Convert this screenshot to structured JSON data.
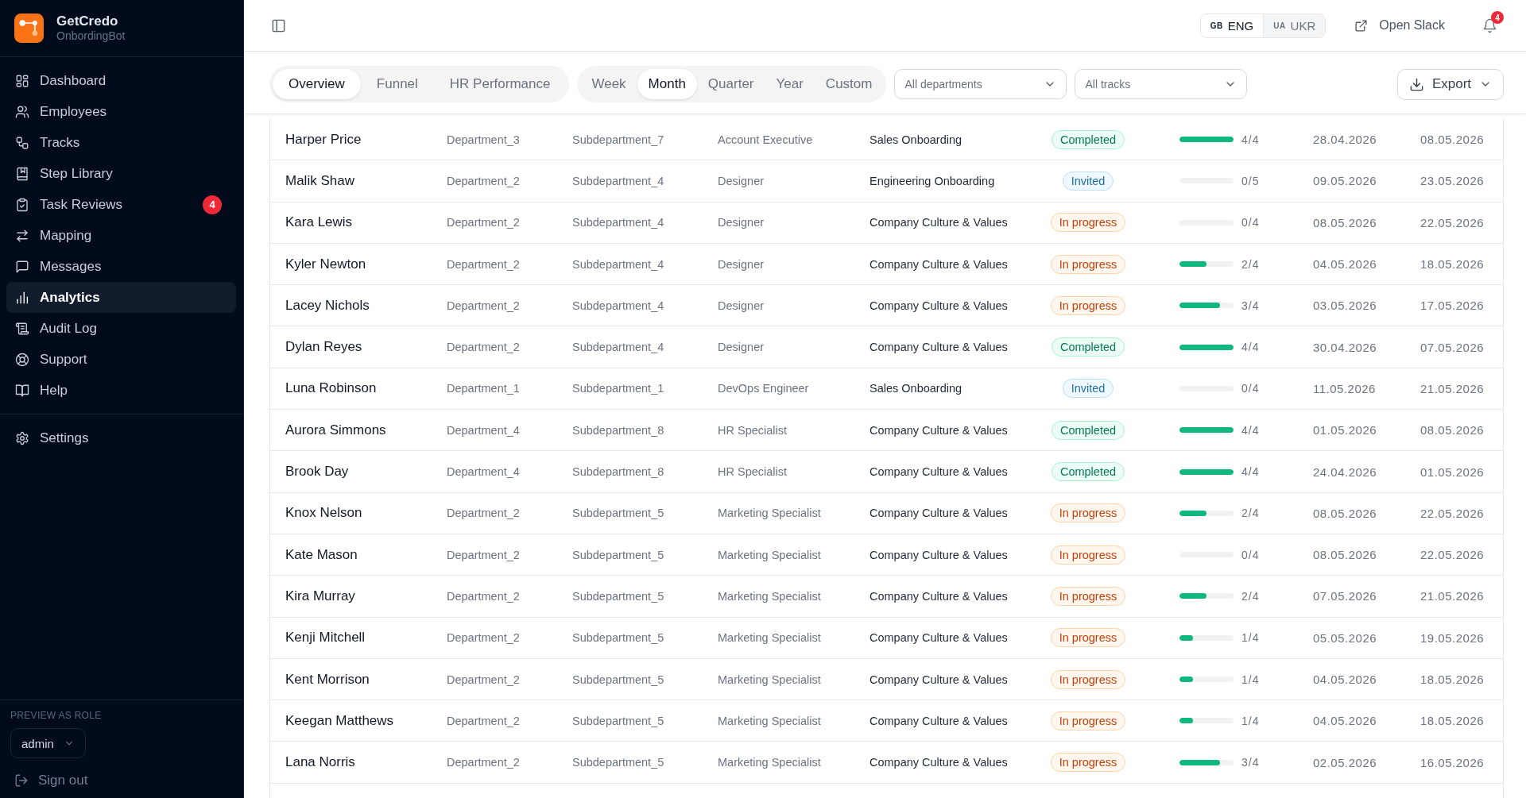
{
  "sidebar": {
    "brand": {
      "name": "GetCredo",
      "subtitle": "OnbordingBot"
    },
    "nav": [
      {
        "label": "Dashboard",
        "selected": false
      },
      {
        "label": "Employees",
        "selected": false
      },
      {
        "label": "Tracks",
        "selected": false
      },
      {
        "label": "Step Library",
        "selected": false
      },
      {
        "label": "Task Reviews",
        "selected": false,
        "badge": "4"
      },
      {
        "label": "Mapping",
        "selected": false
      },
      {
        "label": "Messages",
        "selected": false
      },
      {
        "label": "Analytics",
        "selected": true
      },
      {
        "label": "Audit Log",
        "selected": false
      },
      {
        "label": "Support",
        "selected": false
      },
      {
        "label": "Help",
        "selected": false
      }
    ],
    "footer_nav": [
      {
        "label": "Settings",
        "selected": false
      }
    ],
    "role_preview": {
      "label": "PREVIEW AS ROLE",
      "value": "admin"
    },
    "sign_out": "Sign out"
  },
  "topbar": {
    "languages": [
      {
        "code": "GB",
        "label": "ENG",
        "selected": true
      },
      {
        "code": "UA",
        "label": "UKR",
        "selected": false
      }
    ],
    "open_slack": "Open Slack",
    "notifications_badge": "4"
  },
  "toolbar": {
    "view_tabs": [
      {
        "label": "Overview",
        "selected": true
      },
      {
        "label": "Funnel",
        "selected": false
      },
      {
        "label": "HR Performance",
        "selected": false
      }
    ],
    "period_tabs": [
      {
        "label": "Week",
        "selected": false
      },
      {
        "label": "Month",
        "selected": true
      },
      {
        "label": "Quarter",
        "selected": false
      },
      {
        "label": "Year",
        "selected": false
      },
      {
        "label": "Custom",
        "selected": false
      }
    ],
    "filters": [
      {
        "value": "All departments"
      },
      {
        "value": "All tracks"
      }
    ],
    "export": "Export"
  },
  "table": {
    "rows": [
      {
        "employee": "Harper Price",
        "department": "Department_3",
        "subdepartment": "Subdepartment_7",
        "job_title": "Account Executive",
        "track": "Sales Onboarding",
        "status": "Completed",
        "kind": "completed",
        "level": 1,
        "progress": "4/4",
        "date_1": "28.04.2026",
        "date_2": "08.05.2026"
      },
      {
        "employee": "Malik Shaw",
        "department": "Department_2",
        "subdepartment": "Subdepartment_4",
        "job_title": "Designer",
        "track": "Engineering Onboarding",
        "status": "Invited",
        "kind": "invited",
        "level": 0,
        "progress": "0/5",
        "date_1": "09.05.2026",
        "date_2": "23.05.2026"
      },
      {
        "employee": "Kara Lewis",
        "department": "Department_2",
        "subdepartment": "Subdepartment_4",
        "job_title": "Designer",
        "track": "Company Culture & Values",
        "status": "In progress",
        "kind": "in_progress",
        "level": 0,
        "progress": "0/4",
        "date_1": "08.05.2026",
        "date_2": "22.05.2026"
      },
      {
        "employee": "Kyler Newton",
        "department": "Department_2",
        "subdepartment": "Subdepartment_4",
        "job_title": "Designer",
        "track": "Company Culture & Values",
        "status": "In progress",
        "kind": "in_progress",
        "level": 0.5,
        "progress": "2/4",
        "date_1": "04.05.2026",
        "date_2": "18.05.2026"
      },
      {
        "employee": "Lacey Nichols",
        "department": "Department_2",
        "subdepartment": "Subdepartment_4",
        "job_title": "Designer",
        "track": "Company Culture & Values",
        "status": "In progress",
        "kind": "in_progress",
        "level": 0.75,
        "progress": "3/4",
        "date_1": "03.05.2026",
        "date_2": "17.05.2026"
      },
      {
        "employee": "Dylan Reyes",
        "department": "Department_2",
        "subdepartment": "Subdepartment_4",
        "job_title": "Designer",
        "track": "Company Culture & Values",
        "status": "Completed",
        "kind": "completed",
        "level": 1,
        "progress": "4/4",
        "date_1": "30.04.2026",
        "date_2": "07.05.2026"
      },
      {
        "employee": "Luna Robinson",
        "department": "Department_1",
        "subdepartment": "Subdepartment_1",
        "job_title": "DevOps Engineer",
        "track": "Sales Onboarding",
        "status": "Invited",
        "kind": "invited",
        "level": 0,
        "progress": "0/4",
        "date_1": "11.05.2026",
        "date_2": "21.05.2026"
      },
      {
        "employee": "Aurora Simmons",
        "department": "Department_4",
        "subdepartment": "Subdepartment_8",
        "job_title": "HR Specialist",
        "track": "Company Culture & Values",
        "status": "Completed",
        "kind": "completed",
        "level": 1,
        "progress": "4/4",
        "date_1": "01.05.2026",
        "date_2": "08.05.2026"
      },
      {
        "employee": "Brook Day",
        "department": "Department_4",
        "subdepartment": "Subdepartment_8",
        "job_title": "HR Specialist",
        "track": "Company Culture & Values",
        "status": "Completed",
        "kind": "completed",
        "level": 1,
        "progress": "4/4",
        "date_1": "24.04.2026",
        "date_2": "01.05.2026"
      },
      {
        "employee": "Knox Nelson",
        "department": "Department_2",
        "subdepartment": "Subdepartment_5",
        "job_title": "Marketing Specialist",
        "track": "Company Culture & Values",
        "status": "In progress",
        "kind": "in_progress",
        "level": 0.5,
        "progress": "2/4",
        "date_1": "08.05.2026",
        "date_2": "22.05.2026"
      },
      {
        "employee": "Kate Mason",
        "department": "Department_2",
        "subdepartment": "Subdepartment_5",
        "job_title": "Marketing Specialist",
        "track": "Company Culture & Values",
        "status": "In progress",
        "kind": "in_progress",
        "level": 0,
        "progress": "0/4",
        "date_1": "08.05.2026",
        "date_2": "22.05.2026"
      },
      {
        "employee": "Kira Murray",
        "department": "Department_2",
        "subdepartment": "Subdepartment_5",
        "job_title": "Marketing Specialist",
        "track": "Company Culture & Values",
        "status": "In progress",
        "kind": "in_progress",
        "level": 0.5,
        "progress": "2/4",
        "date_1": "07.05.2026",
        "date_2": "21.05.2026"
      },
      {
        "employee": "Kenji Mitchell",
        "department": "Department_2",
        "subdepartment": "Subdepartment_5",
        "job_title": "Marketing Specialist",
        "track": "Company Culture & Values",
        "status": "In progress",
        "kind": "in_progress",
        "level": 0.25,
        "progress": "1/4",
        "date_1": "05.05.2026",
        "date_2": "19.05.2026"
      },
      {
        "employee": "Kent Morrison",
        "department": "Department_2",
        "subdepartment": "Subdepartment_5",
        "job_title": "Marketing Specialist",
        "track": "Company Culture & Values",
        "status": "In progress",
        "kind": "in_progress",
        "level": 0.25,
        "progress": "1/4",
        "date_1": "04.05.2026",
        "date_2": "18.05.2026"
      },
      {
        "employee": "Keegan Matthews",
        "department": "Department_2",
        "subdepartment": "Subdepartment_5",
        "job_title": "Marketing Specialist",
        "track": "Company Culture & Values",
        "status": "In progress",
        "kind": "in_progress",
        "level": 0.25,
        "progress": "1/4",
        "date_1": "04.05.2026",
        "date_2": "18.05.2026"
      },
      {
        "employee": "Lana Norris",
        "department": "Department_2",
        "subdepartment": "Subdepartment_5",
        "job_title": "Marketing Specialist",
        "track": "Company Culture & Values",
        "status": "In progress",
        "kind": "in_progress",
        "level": 0.75,
        "progress": "3/4",
        "date_1": "02.05.2026",
        "date_2": "16.05.2026"
      }
    ]
  }
}
